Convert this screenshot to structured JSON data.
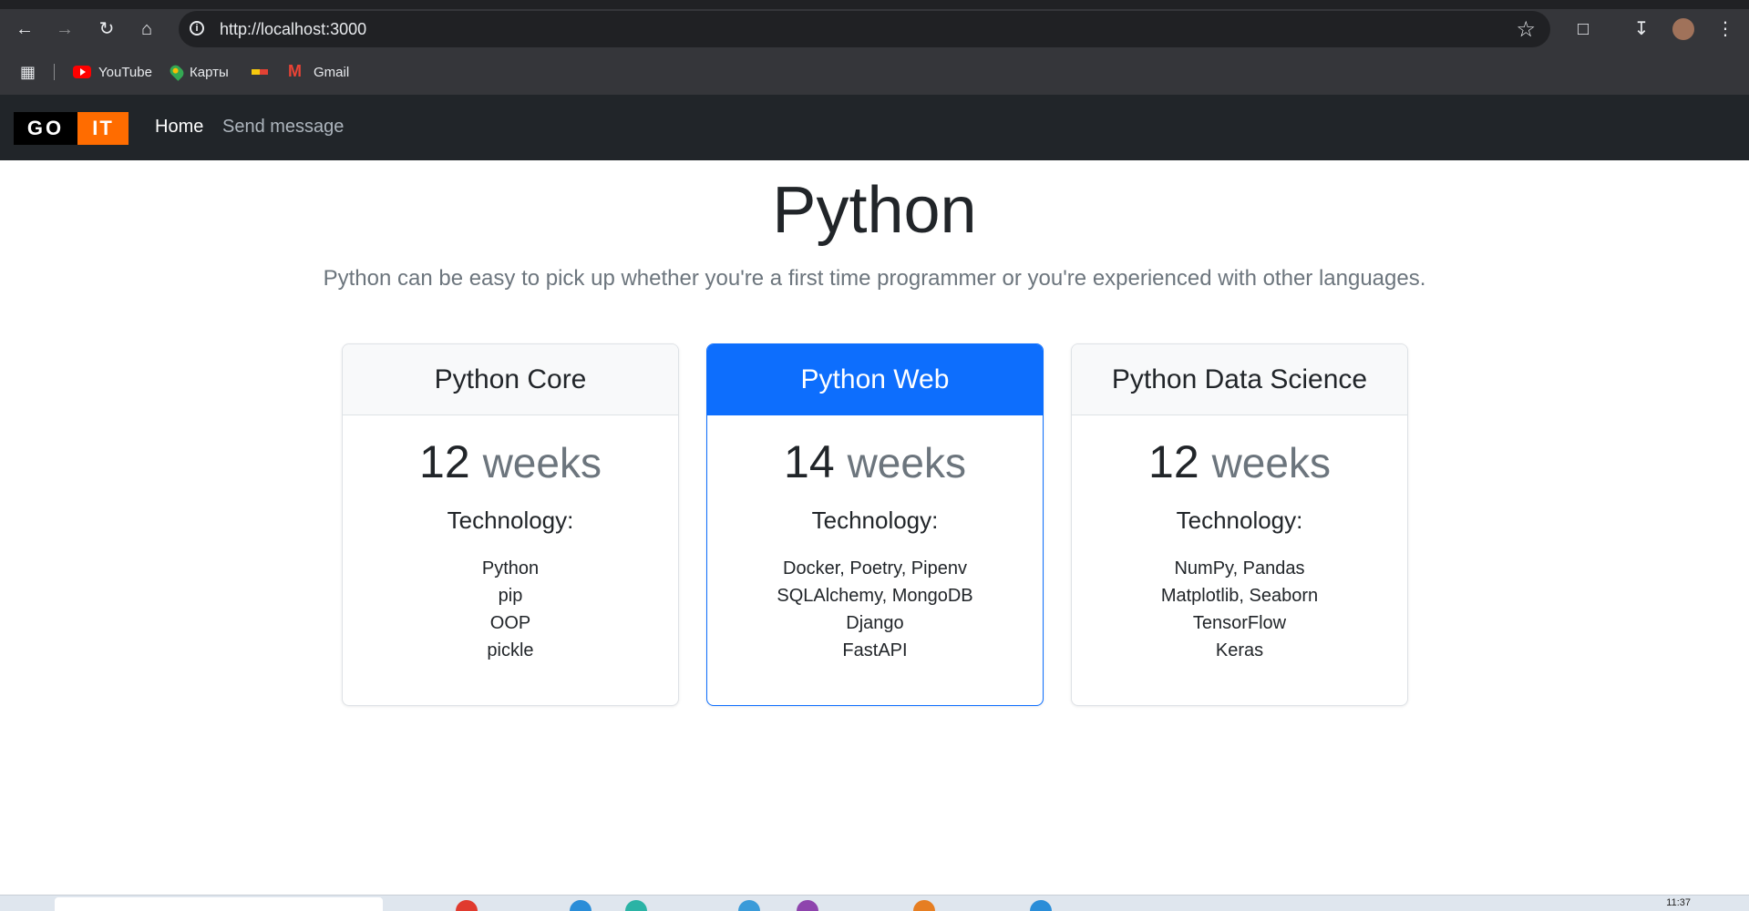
{
  "browser": {
    "url": "http://localhost:3000",
    "bookmarks": [
      {
        "label": "YouTube",
        "icon": "youtube-icon"
      },
      {
        "label": "Карты",
        "icon": "maps-icon"
      },
      {
        "label": "",
        "icon": "bookmark-flag-icon"
      },
      {
        "label": "Gmail",
        "icon": "gmail-icon"
      }
    ]
  },
  "navbar": {
    "logo_left": "GO",
    "logo_right": "IT",
    "links": [
      {
        "label": "Home",
        "active": true
      },
      {
        "label": "Send message",
        "active": false
      }
    ]
  },
  "hero": {
    "title": "Python",
    "lead": "Python can be easy to pick up whether you're a first time programmer or you're experienced with other languages."
  },
  "cards": [
    {
      "title": "Python Core",
      "duration": "12",
      "unit": "weeks",
      "tech_title": "Technology:",
      "tech": [
        "Python",
        "pip",
        "OOP",
        "pickle"
      ]
    },
    {
      "title": "Python Web",
      "duration": "14",
      "unit": "weeks",
      "tech_title": "Technology:",
      "tech": [
        "Docker, Poetry, Pipenv",
        "SQLAlchemy, MongoDB",
        "Django",
        "FastAPI"
      ]
    },
    {
      "title": "Python Data Science",
      "duration": "12",
      "unit": "weeks",
      "tech_title": "Technology:",
      "tech": [
        "NumPy, Pandas",
        "Matplotlib, Seaborn",
        "TensorFlow",
        "Keras"
      ]
    }
  ],
  "taskbar": {
    "clock": "11:37"
  },
  "colors": {
    "primary": "#0d6efd",
    "navbar": "#212529",
    "brand_orange": "#ff6c00"
  }
}
